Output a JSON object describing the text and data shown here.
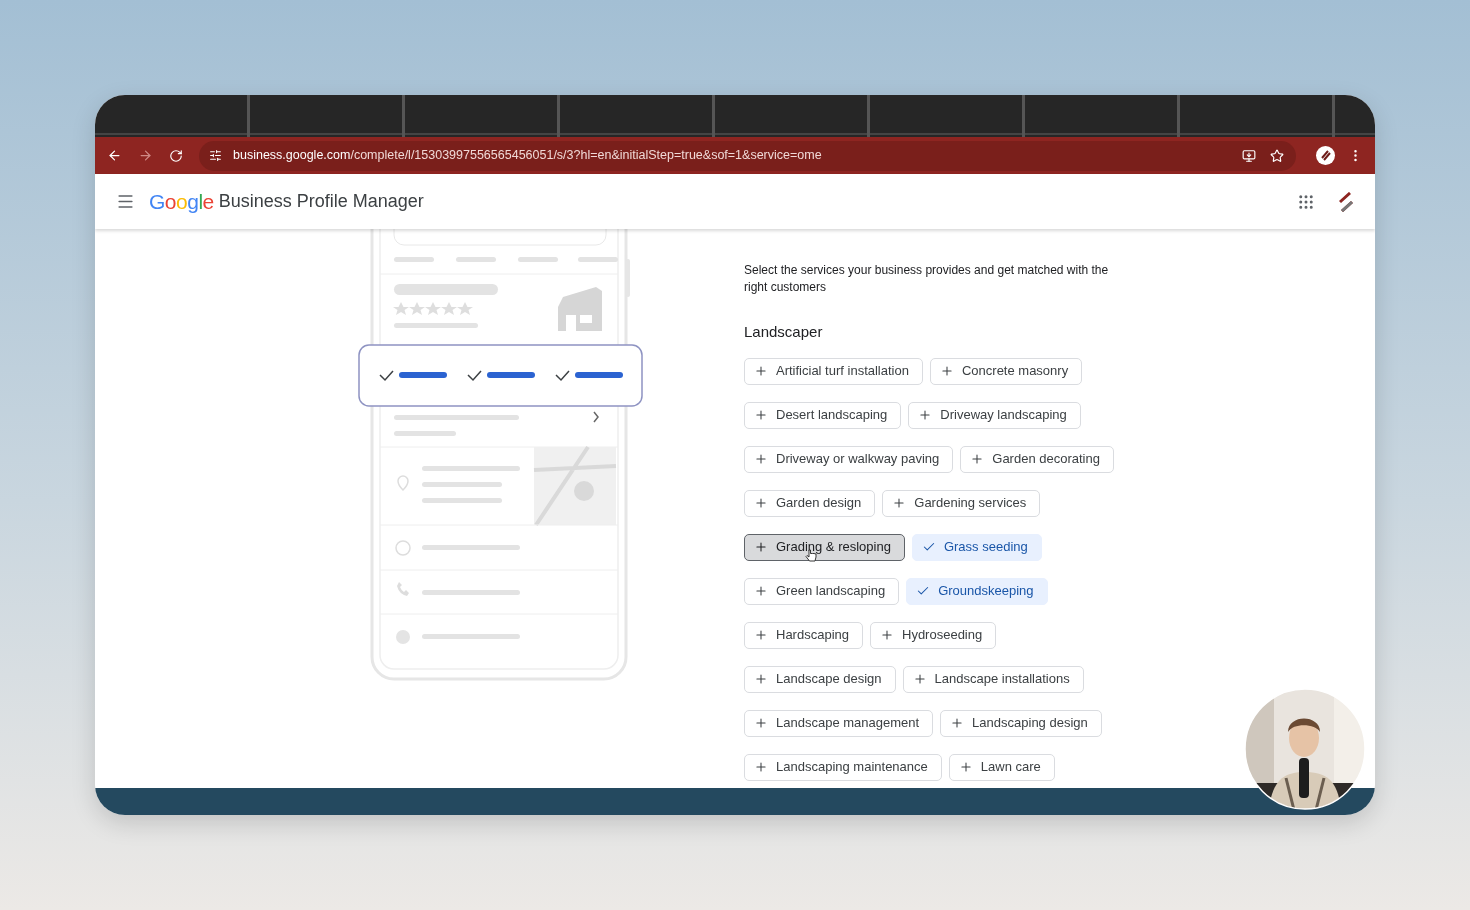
{
  "browser": {
    "url_domain": "business.google.com",
    "url_path": "/complete/l/15303997556565456051/s/3?hl=en&initialStep=true&sof=1&service=ome",
    "forward_disabled": true
  },
  "header": {
    "logo": "Google",
    "title": "Business Profile Manager"
  },
  "services": {
    "description": "Select the services your business provides and get matched with the right customers",
    "category": "Landscaper",
    "rows": [
      {
        "chips": [
          {
            "label": "Artificial turf installation",
            "checked": false,
            "hovered": false
          },
          {
            "label": "Concrete masonry",
            "checked": false,
            "hovered": false
          }
        ]
      },
      {
        "chips": [
          {
            "label": "Desert landscaping",
            "checked": false,
            "hovered": false
          },
          {
            "label": "Driveway landscaping",
            "checked": false,
            "hovered": false
          }
        ]
      },
      {
        "chips": [
          {
            "label": "Driveway or walkway paving",
            "checked": false,
            "hovered": false
          },
          {
            "label": "Garden decorating",
            "checked": false,
            "hovered": false
          }
        ]
      },
      {
        "chips": [
          {
            "label": "Garden design",
            "checked": false,
            "hovered": false
          },
          {
            "label": "Gardening services",
            "checked": false,
            "hovered": false
          }
        ]
      },
      {
        "chips": [
          {
            "label": "Grading & resloping",
            "checked": false,
            "hovered": true
          },
          {
            "label": "Grass seeding",
            "checked": true,
            "hovered": false
          }
        ]
      },
      {
        "chips": [
          {
            "label": "Green landscaping",
            "checked": false,
            "hovered": false
          },
          {
            "label": "Groundskeeping",
            "checked": true,
            "hovered": false
          }
        ]
      },
      {
        "chips": [
          {
            "label": "Hardscaping",
            "checked": false,
            "hovered": false
          },
          {
            "label": "Hydroseeding",
            "checked": false,
            "hovered": false
          }
        ]
      },
      {
        "chips": [
          {
            "label": "Landscape design",
            "checked": false,
            "hovered": false
          },
          {
            "label": "Landscape installations",
            "checked": false,
            "hovered": false
          }
        ]
      },
      {
        "chips": [
          {
            "label": "Landscape management",
            "checked": false,
            "hovered": false
          },
          {
            "label": "Landscaping design",
            "checked": false,
            "hovered": false
          }
        ]
      },
      {
        "chips": [
          {
            "label": "Landscaping maintenance",
            "checked": false,
            "hovered": false
          },
          {
            "label": "Lawn care",
            "checked": false,
            "hovered": false
          }
        ]
      }
    ]
  }
}
